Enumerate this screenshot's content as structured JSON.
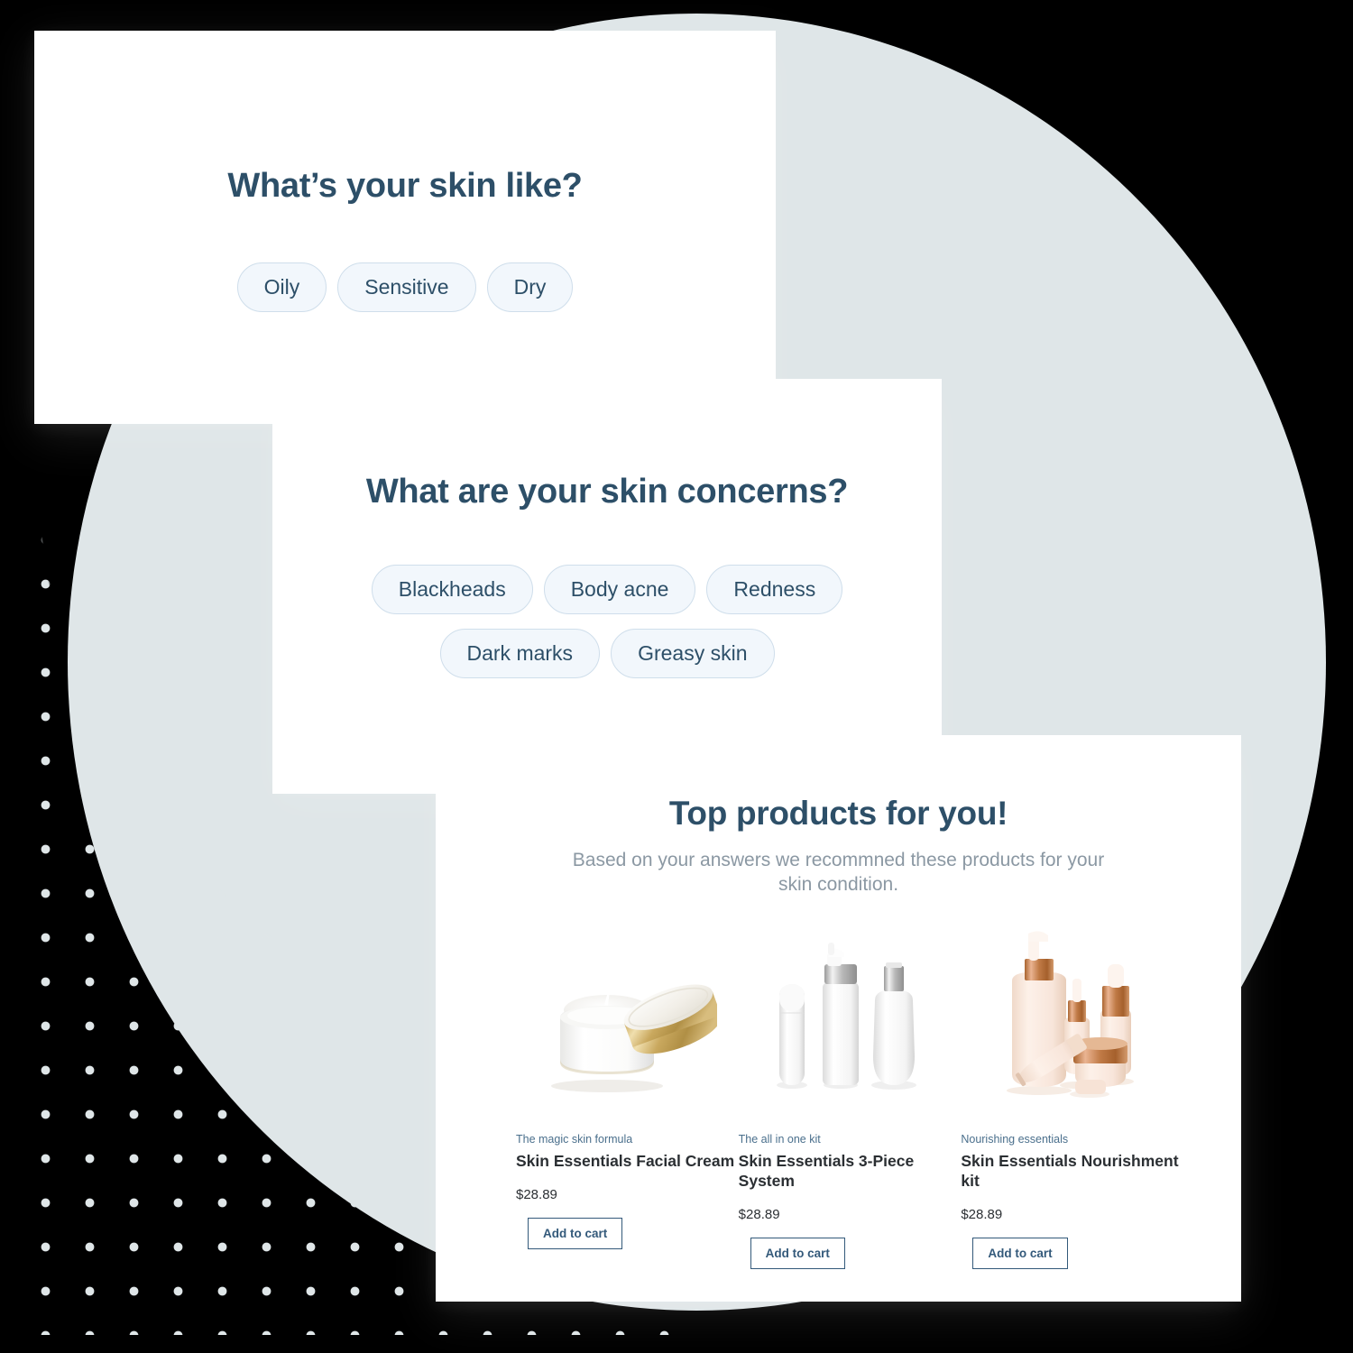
{
  "theme": {
    "background": "#000000",
    "circle_color": "#dfe6e8",
    "dot_color": "#dfe6e8",
    "card_bg": "#ffffff",
    "heading_color": "#2d4f68",
    "chip_bg": "#f2f7fc",
    "chip_border": "#cfdeeb",
    "subtitle_color": "#8b98a3",
    "button_border": "#33597a"
  },
  "skin_type_card": {
    "title": "What’s your skin like?",
    "options": [
      "Oily",
      "Sensitive",
      "Dry"
    ]
  },
  "concerns_card": {
    "title": "What are your skin concerns?",
    "options_row1": [
      "Blackheads",
      "Body acne",
      "Redness"
    ],
    "options_row2": [
      "Dark marks",
      "Greasy skin"
    ]
  },
  "products_card": {
    "title": "Top products for you!",
    "subtitle": "Based on your answers we recommned these products for your skin condition.",
    "items": [
      {
        "eyebrow": "The magic skin formula",
        "name": "Skin Essentials Facial Cream",
        "price": "$28.89",
        "cta": "Add to cart",
        "image": "cream-jar-gold-lid"
      },
      {
        "eyebrow": "The all in one kit",
        "name": "Skin Essentials 3-Piece System",
        "price": "$28.89",
        "cta": "Add to cart",
        "image": "three-white-bottles"
      },
      {
        "eyebrow": "Nourishing essentials",
        "name": "Skin Essentials Nourishment kit",
        "price": "$28.89",
        "cta": "Add to cart",
        "image": "rose-gold-collection"
      }
    ]
  }
}
